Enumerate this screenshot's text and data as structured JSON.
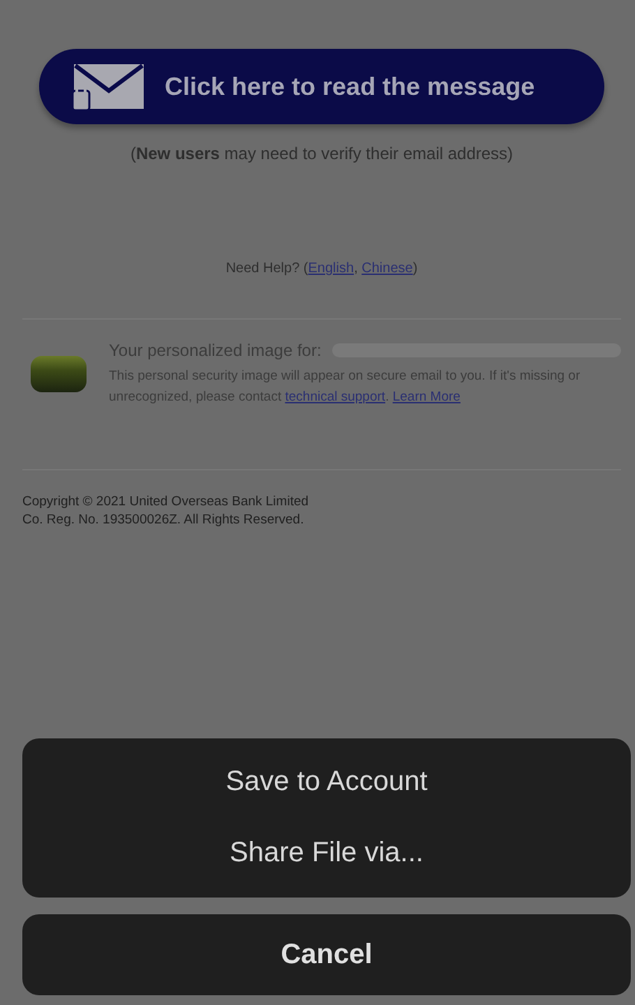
{
  "email": {
    "read_button": "Click here to read the message",
    "verify_note": "(**New users** may need to verify their email address)",
    "help": [
      {
        "kind": "text",
        "text": "Need Help? ("
      },
      {
        "kind": "link",
        "text": "English"
      },
      {
        "kind": "text",
        "text": ", "
      },
      {
        "kind": "link",
        "text": "Chinese"
      },
      {
        "kind": "text",
        "text": ")"
      }
    ],
    "security": {
      "title": "Your personalized image for:",
      "note": [
        {
          "kind": "text",
          "text": "This personal security image will appear on secure email to you. If it's missing or unrecognized, please contact "
        },
        {
          "kind": "link",
          "text": "technical support"
        },
        {
          "kind": "text",
          "text": ". "
        },
        {
          "kind": "link",
          "text": "Learn More"
        }
      ]
    },
    "copyright": [
      "Copyright © 2021 United Overseas Bank Limited",
      "Co. Reg. No. 193500026Z. All Rights Reserved."
    ]
  },
  "action_sheet": {
    "actions": [
      "Save to Account",
      "Share File via..."
    ],
    "cancel": "Cancel"
  }
}
